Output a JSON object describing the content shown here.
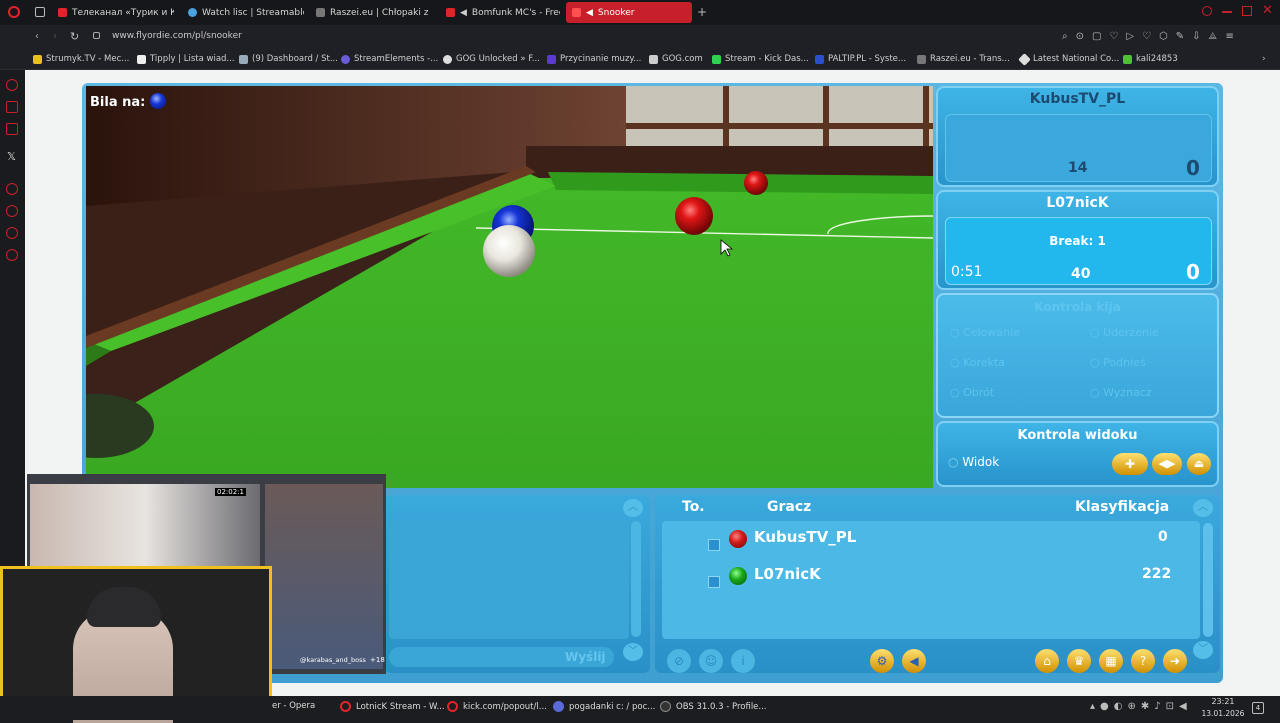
{
  "browser": {
    "tabs": [
      {
        "label": "Телеканал «Турик и Кон",
        "color": "#e0242a"
      },
      {
        "label": "Watch lisc | Streamable",
        "color": "#4aa3e0"
      },
      {
        "label": "Raszei.eu | Chłopaki z Ra",
        "color": "#666"
      },
      {
        "label": "Bomfunk MC's - Frees",
        "color": "#e0242a"
      },
      {
        "label": "Snooker",
        "color": "#e0242a"
      }
    ],
    "url": "www.flyordie.com/pl/snooker",
    "bookmarks": [
      "Strumyk.TV - Mec...",
      "Tipply | Lista wiad...",
      "(9) Dashboard / St...",
      "StreamElements -...",
      "GOG Unlocked » F...",
      "Przycinanie muzy...",
      "GOG.com",
      "Stream - Kick Das...",
      "PALTIP.PL - Syste...",
      "Raszei.eu - Trans...",
      "Latest National Co...",
      "kali24853"
    ]
  },
  "game": {
    "ball_on_label": "Bila na:",
    "ball_on_color": "#1030d0",
    "player1": {
      "name": "KubusTV_PL",
      "left_value": "14",
      "score": "0"
    },
    "player2": {
      "name": "L07nicK",
      "break_label": "Break: 1",
      "timer": "0:51",
      "left_value": "40",
      "score": "0"
    },
    "controls": {
      "title": "Kontrola kija",
      "items": [
        "Celowanie",
        "Uderzenie",
        "Korekta",
        "Podnieś",
        "Obrót",
        "Wyznacz"
      ]
    },
    "view": {
      "title": "Kontrola widoku",
      "item": "Widok"
    },
    "chat": {
      "send_label": "Wyślij"
    },
    "ranking": {
      "headers": [
        "To.",
        "Gracz",
        "Klasyfikacja"
      ],
      "rows": [
        {
          "name": "KubusTV_PL",
          "ball": "#d21a1a",
          "score": "0"
        },
        {
          "name": "L07nicK",
          "ball": "#18a818",
          "score": "222"
        }
      ]
    }
  },
  "stream_overlay": {
    "timer": "02:02:1",
    "user": "@karabas_and_boss",
    "badge": "+18"
  },
  "taskbar": {
    "items": [
      "er - Opera",
      "LotnicK Stream - W...",
      "kick.com/popout/l...",
      "pogadanki c: / poc...",
      "OBS 31.0.3 - Profile..."
    ],
    "time": "23:21",
    "date": "13.01.2026"
  }
}
